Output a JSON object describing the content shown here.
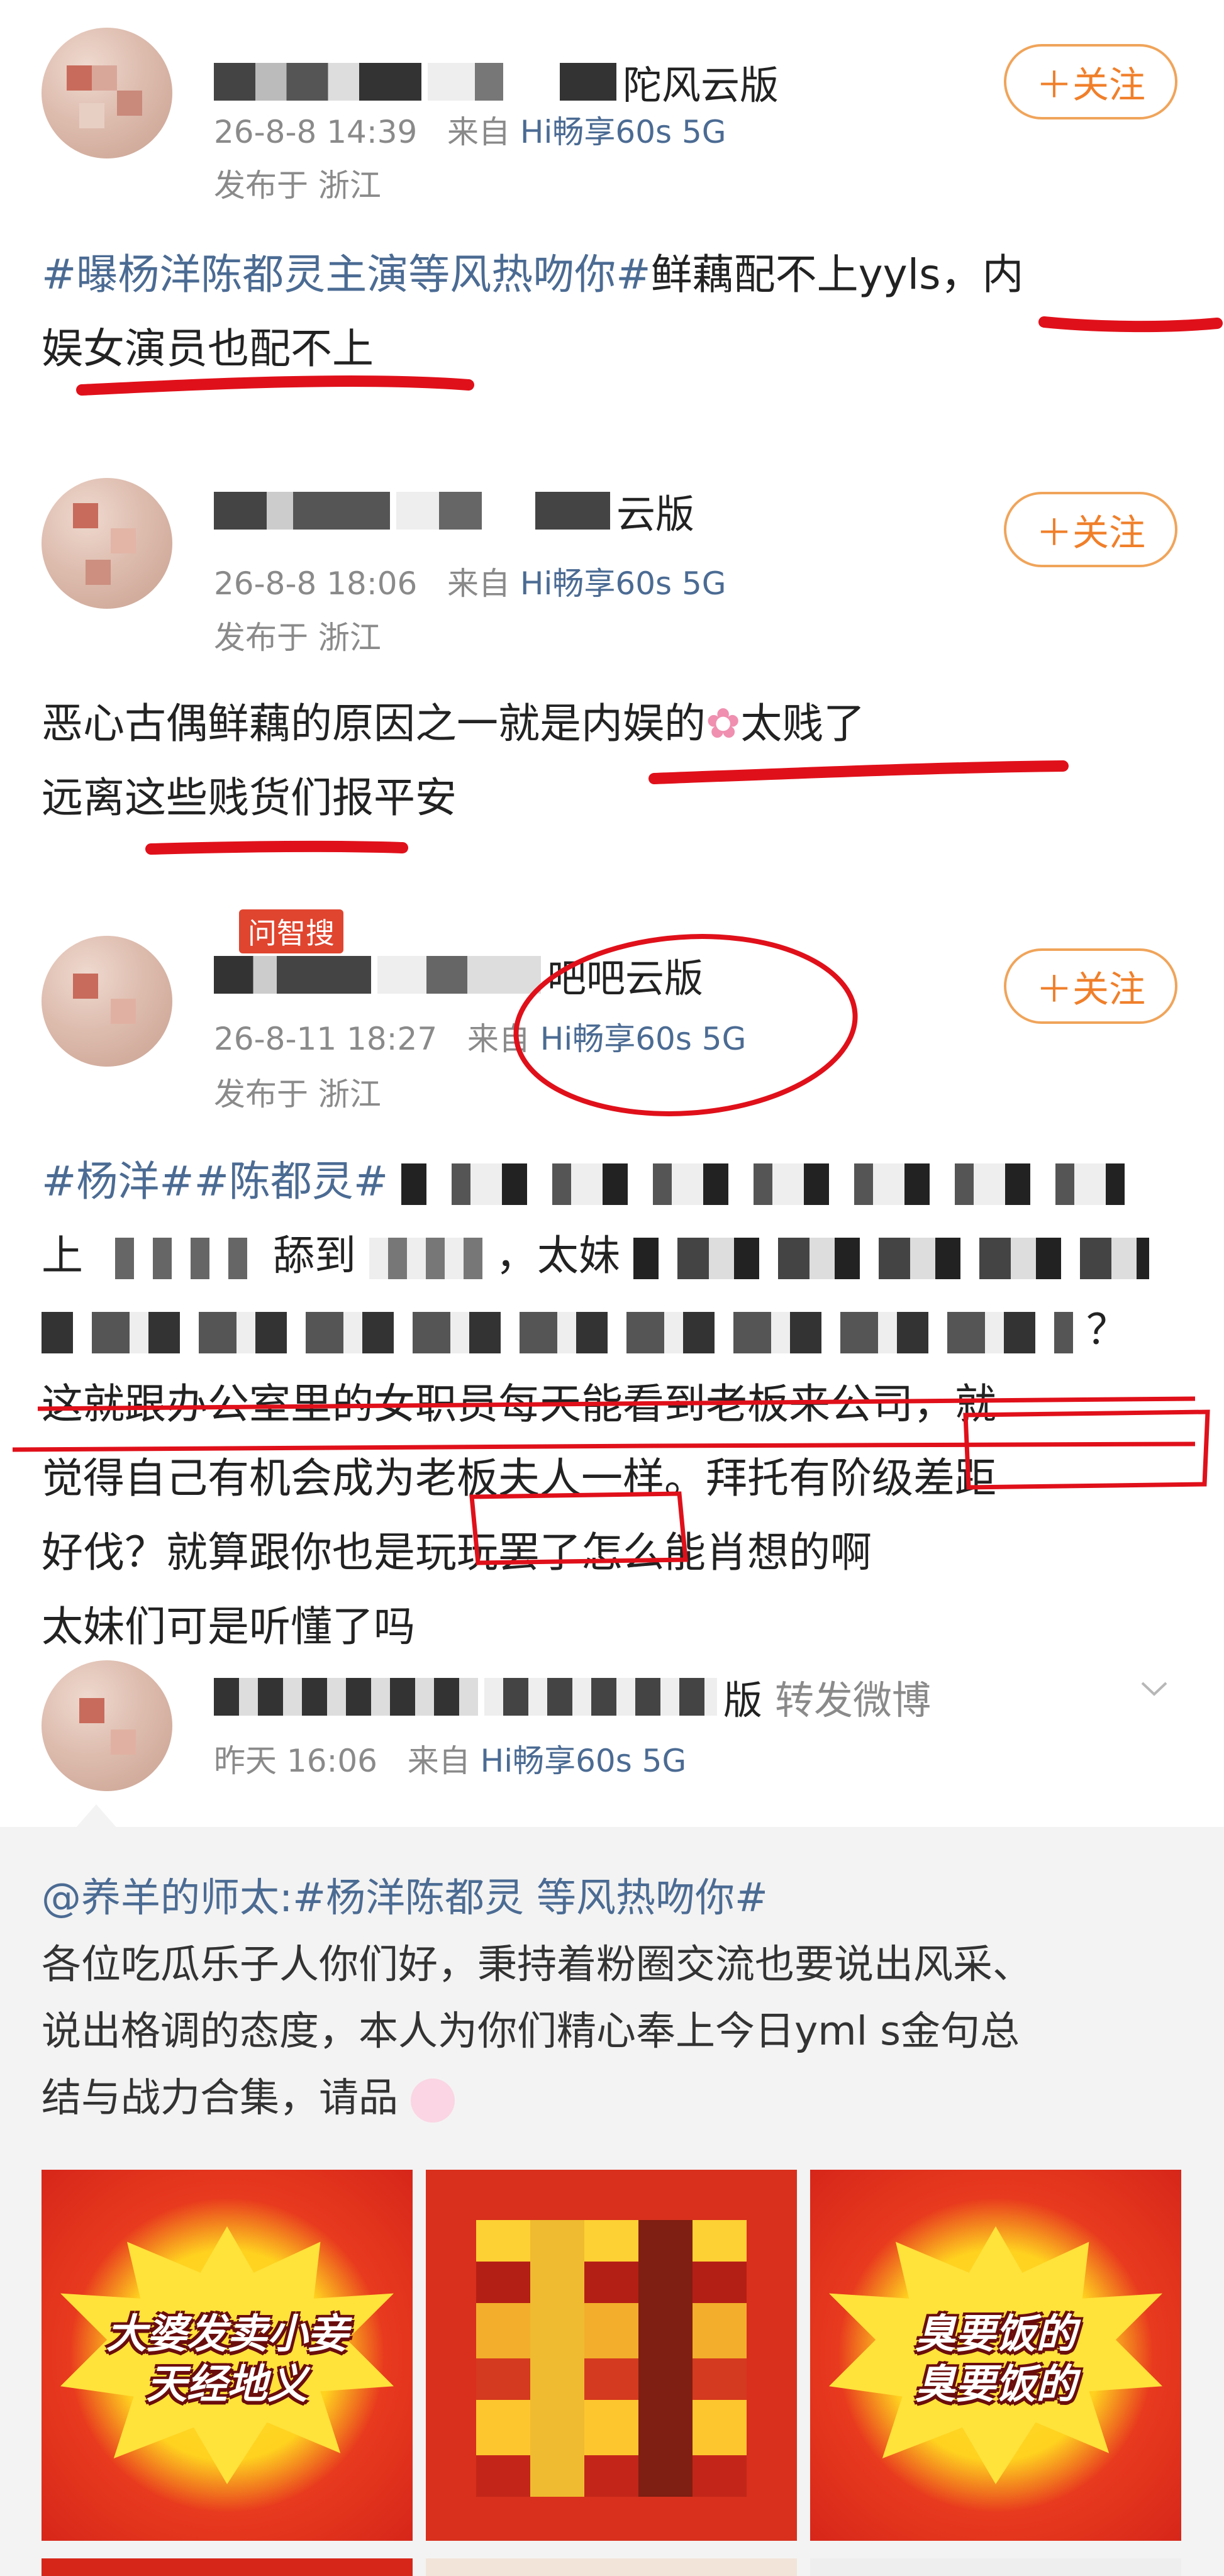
{
  "post1": {
    "username_suffix": "陀风云版",
    "timestamp": "26-8-8 14:39",
    "source_prefix": "来自",
    "device": "Hi畅享60s 5G",
    "location": "发布于 浙江",
    "follow_label": "＋关注",
    "topic": "#曝杨洋陈都灵主演等风热吻你#",
    "text_line1_rest": "鲜藕配不上yyls，内",
    "text_line2": "娱女演员也配不上"
  },
  "post2": {
    "username_suffix": "云版",
    "timestamp": "26-8-8 18:06",
    "source_prefix": "来自",
    "device": "Hi畅享60s 5G",
    "location": "发布于 浙江",
    "follow_label": "＋关注",
    "text_line1_a": "恶心古偶鲜藕的原因之一就是内娱的",
    "text_line1_b": "太贱了",
    "text_line2": "远离这些贱货们报平安"
  },
  "post3": {
    "badge": "问智搜",
    "username_suffix": "吧吧云版",
    "timestamp": "26-8-11 18:27",
    "source_prefix": "来自",
    "device": "Hi畅享60s 5G",
    "location": "发布于 浙江",
    "follow_label": "＋关注",
    "topic1": "#杨洋#",
    "topic2": "#陈都灵#",
    "line2_a": "上",
    "line2_b": "舔到",
    "line2_c": "，太妹",
    "line3_end": "？",
    "line4": "这就跟办公室里的女职员每天能看到老板来公司，就",
    "line5": "觉得自己有机会成为老板夫人一样。拜托有阶级差距",
    "line6": "好伐？就算跟你也是玩玩罢了怎么能肖想的啊",
    "line7": "太妹们可是听懂了吗"
  },
  "post4": {
    "username_suffix": "版",
    "action": "转发微博",
    "timestamp": "昨天 16:06",
    "source_prefix": "来自",
    "device": "Hi畅享60s 5G",
    "repost_author": "@养羊的师太:",
    "repost_topic": "#杨洋陈都灵 等风热吻你#",
    "repost_line1": "各位吃瓜乐子人你们好，秉持着粉圈交流也要说出风采、",
    "repost_line2": "说出格调的态度，本人为你们精心奉上今日yml s金句总",
    "repost_line3": "结与战力合集，请品",
    "thumbs": [
      {
        "line1": "大婆发卖小妾",
        "line2": "天经地义"
      },
      {
        "line1": "",
        "line2": ""
      },
      {
        "line1": "臭要饭的",
        "line2": "臭要饭的"
      }
    ]
  },
  "colors": {
    "topic": "#4b6b93",
    "follow": "#f07f2a",
    "annotation_red": "#e0101a",
    "meta": "#8a8a8a"
  }
}
